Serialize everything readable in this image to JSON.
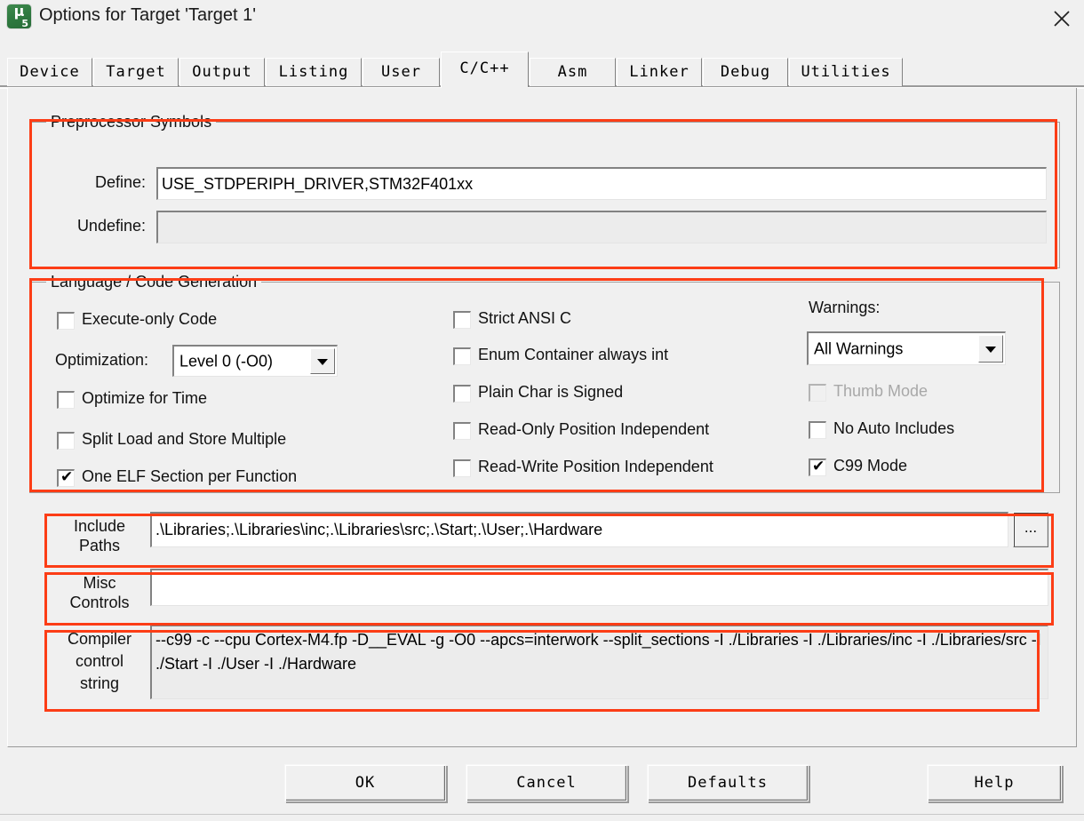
{
  "window": {
    "title": "Options for Target 'Target 1'",
    "app_icon": "keil-uvision5-icon",
    "icon_mu": "μ",
    "icon_version": "5",
    "close_icon": "close-icon"
  },
  "tabs": [
    {
      "label": "Device",
      "active": false
    },
    {
      "label": "Target",
      "active": false
    },
    {
      "label": "Output",
      "active": false
    },
    {
      "label": "Listing",
      "active": false
    },
    {
      "label": "User",
      "active": false
    },
    {
      "label": "C/C++",
      "active": true
    },
    {
      "label": "Asm",
      "active": false
    },
    {
      "label": "Linker",
      "active": false
    },
    {
      "label": "Debug",
      "active": false
    },
    {
      "label": "Utilities",
      "active": false
    }
  ],
  "preprocessor": {
    "group_title": "Preprocessor Symbols",
    "define_label": "Define:",
    "define_value": "USE_STDPERIPH_DRIVER,STM32F401xx",
    "undefine_label": "Undefine:",
    "undefine_value": ""
  },
  "language": {
    "group_title": "Language / Code Generation",
    "optimization_label": "Optimization:",
    "optimization_value": "Level 0 (-O0)",
    "warnings_label": "Warnings:",
    "warnings_value": "All Warnings",
    "col_left": [
      {
        "label": "Execute-only Code",
        "checked": false,
        "disabled": false
      },
      {
        "label": "Optimize for Time",
        "checked": false,
        "disabled": false
      },
      {
        "label": "Split Load and Store Multiple",
        "checked": false,
        "disabled": false
      },
      {
        "label": "One ELF Section per Function",
        "checked": true,
        "disabled": false
      }
    ],
    "col_middle": [
      {
        "label": "Strict ANSI C",
        "checked": false,
        "disabled": false
      },
      {
        "label": "Enum Container always int",
        "checked": false,
        "disabled": false
      },
      {
        "label": "Plain Char is Signed",
        "checked": false,
        "disabled": false
      },
      {
        "label": "Read-Only Position Independent",
        "checked": false,
        "disabled": false
      },
      {
        "label": "Read-Write Position Independent",
        "checked": false,
        "disabled": false
      }
    ],
    "col_right": [
      {
        "label": "Thumb Mode",
        "checked": false,
        "disabled": true
      },
      {
        "label": "No Auto Includes",
        "checked": false,
        "disabled": false
      },
      {
        "label": "C99 Mode",
        "checked": true,
        "disabled": false
      }
    ],
    "checkmark": "✔"
  },
  "paths": {
    "include_label_line1": "Include",
    "include_label_line2": "Paths",
    "include_value": ".\\Libraries;.\\Libraries\\inc;.\\Libraries\\src;.\\Start;.\\User;.\\Hardware",
    "browse_label": "...",
    "misc_label_line1": "Misc",
    "misc_label_line2": "Controls",
    "misc_value": "",
    "compiler_label_line1": "Compiler",
    "compiler_label_line2": "control",
    "compiler_label_line3": "string",
    "compiler_value": "--c99 -c --cpu Cortex-M4.fp -D__EVAL -g -O0 --apcs=interwork --split_sections -I ./Libraries -I ./Libraries/inc -I ./Libraries/src -I ./Start -I ./User -I ./Hardware"
  },
  "buttons": {
    "ok": "OK",
    "cancel": "Cancel",
    "defaults": "Defaults",
    "help": "Help"
  },
  "annotation": {
    "color": "#fc3d16"
  }
}
